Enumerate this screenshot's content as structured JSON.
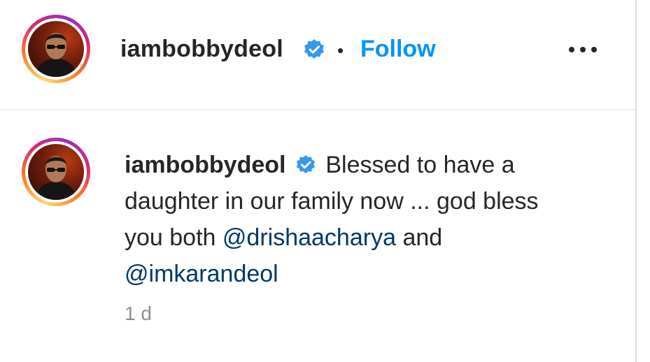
{
  "post_header": {
    "username": "iambobbydeol",
    "separator": "•",
    "follow_label": "Follow",
    "more_icon": "more-horizontal-icon",
    "verified_icon": "verified-badge-icon"
  },
  "caption": {
    "username": "iambobbydeol",
    "text_part_1": "Blessed to have a daughter in our family now ... god bless you both",
    "mention_1": "@drishaacharya",
    "text_part_2": "and",
    "mention_2": "@imkarandeol",
    "timestamp": "1 d"
  },
  "colors": {
    "accent_link": "#0095f6",
    "mention": "#00376b",
    "verified": "#3897f0",
    "text_primary": "#262626",
    "text_secondary": "#8e8e8e",
    "divider": "#efefef"
  }
}
